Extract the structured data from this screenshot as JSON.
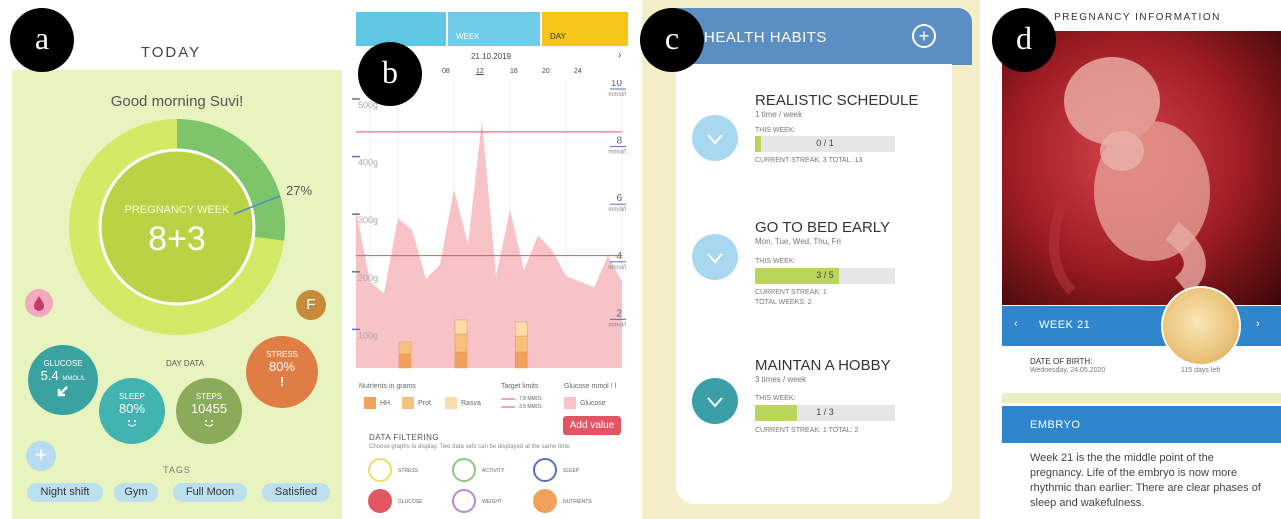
{
  "markers": {
    "a": "a",
    "b": "b",
    "c": "c",
    "d": "d"
  },
  "panel_a": {
    "title": "TODAY",
    "greeting": "Good morning Suvi!",
    "ring_label": "PREGNANCY WEEK",
    "ring_value": "8+3",
    "ring_progress": 0.27,
    "percent": "27%",
    "f_button": "F",
    "day_data": "DAY DATA",
    "glucose": {
      "label": "GLUCOSE",
      "value": "5.4",
      "unit": "MMOL/L"
    },
    "sleep": {
      "label": "SLEEP",
      "value": "80%"
    },
    "steps": {
      "label": "STEPS",
      "value": "10455"
    },
    "stress": {
      "label": "STRESS",
      "value": "80%",
      "mark": "!"
    },
    "tags_title": "TAGS",
    "tags": [
      "Night shift",
      "Gym",
      "Full Moon",
      "Satisfied"
    ],
    "colors": {
      "bg": "#e8f4c0",
      "ring": "#c7df5a",
      "accent": "#7dbf5a"
    }
  },
  "panel_b": {
    "tabs": {
      "week": "WEEK",
      "day": "DAY"
    },
    "date": "21.10.2019",
    "hours": [
      "06",
      "08",
      "12",
      "16",
      "20",
      "24"
    ],
    "left_axis": [
      "500g",
      "400g",
      "300g",
      "200g",
      "100g"
    ],
    "right_axis": [
      {
        "v": "10",
        "u": "mmol/l"
      },
      {
        "v": "8",
        "u": "mmol/l"
      },
      {
        "v": "6",
        "u": "mmol/l"
      },
      {
        "v": "4",
        "u": "mmol/l"
      },
      {
        "v": "2",
        "u": "mmol/l"
      }
    ],
    "legend": {
      "nutrients_title": "Nutrients in grams",
      "target_title": "Target limits",
      "glucose_title": "Glucose mmol / l",
      "hh": "HH.",
      "prot": "Prot.",
      "rasva": "Rasva",
      "limit1": "7.8 MMOL",
      "limit2": "3.5 MMOL",
      "glucose": "Glucose"
    },
    "add_value": "Add value",
    "filter_title": "DATA FILTERING",
    "filter_sub": "Choose graphs to display. Two data sets can be displayed at the same time.",
    "filters": [
      "STRESS",
      "ACTIVITY",
      "SLEEP",
      "GLUCOSE",
      "WEIGHT",
      "NUTRIENTS"
    ],
    "chart_data": {
      "type": "area",
      "x": [
        5,
        6,
        7,
        8,
        9,
        10,
        11,
        12,
        13,
        14,
        15,
        16,
        17,
        18,
        19,
        20,
        21,
        22,
        23,
        24
      ],
      "series": [
        {
          "name": "Glucose",
          "values": [
            5.5,
            3.0,
            2.6,
            5.2,
            4.8,
            3.1,
            3.6,
            6.2,
            4.3,
            8.6,
            3.2,
            5.5,
            3.4,
            4.6,
            4.1,
            3.2,
            3.0,
            2.8,
            3.9,
            3.0
          ]
        }
      ],
      "nutrient_bars_hours": [
        8.5,
        12.5,
        16.8
      ],
      "ylim_left": [
        0,
        500
      ],
      "ylim_right": [
        0,
        10
      ]
    }
  },
  "panel_c": {
    "title": "HEALTH HABITS",
    "plus": "+",
    "habits": [
      {
        "name": "REALISTIC SCHEDULE",
        "freq": "1 time / week",
        "this_week": "THIS WEEK:",
        "progress": "0 / 1",
        "fill": 0.04,
        "stats": "CURRENT STREAK:  3    TOTAL:  13",
        "circle": "#a8d8ef"
      },
      {
        "name": "GO TO BED EARLY",
        "freq": "Mon, Tue, Wed, Thu, Fri",
        "this_week": "THIS WEEK:",
        "progress": "3 / 5",
        "fill": 0.6,
        "stats": "CURRENT STREAK:  1",
        "stats2": "TOTAL WEEKS:  2",
        "circle": "#a8d8ef"
      },
      {
        "name": "MAINTAN A HOBBY",
        "freq": "3 times / week",
        "this_week": "THIS WEEK:",
        "progress": "1 / 3",
        "fill": 0.3,
        "stats": "CURRENT STREAK:  1    TOTAL:  2",
        "circle": "#3a9fa6"
      }
    ]
  },
  "panel_d": {
    "title": "PREGNANCY INFORMATION",
    "week": "WEEK 21",
    "dob_label": "DATE OF BIRTH:",
    "dob_value": "Wednesday, 24.05.2020",
    "days_left": "115 days left",
    "section": "EMBRYO",
    "text": "Week 21 is the the middle point of the pregnancy. Life of the embryo is now more rhythmic than earlier: There are clear phases of sleep and wakefulness."
  }
}
